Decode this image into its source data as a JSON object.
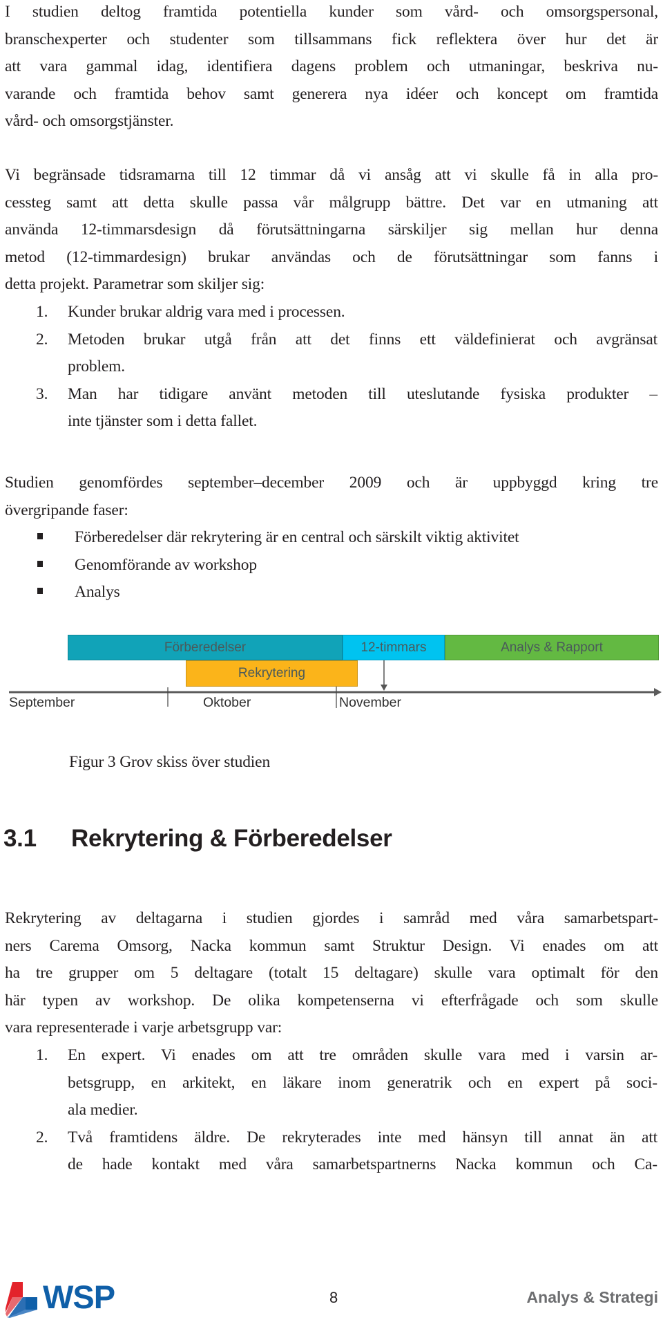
{
  "paragraphs": {
    "intro": [
      "I studien deltog framtida potentiella kunder som vård- och omsorgspersonal,",
      "branschexperter och studenter som tillsammans fick reflektera över hur det är",
      "att vara gammal idag, identifiera dagens problem och utmaningar, beskriva nu-",
      "varande och framtida behov samt generera nya idéer och koncept om framtida",
      "vård- och omsorgstjänster."
    ],
    "timeframe": [
      "Vi begränsade tidsramarna till 12 timmar då vi ansåg att vi skulle få in alla pro-",
      "cessteg samt att detta skulle passa vår målgrupp bättre. Det var en utmaning att",
      "använda 12-timmarsdesign då förutsättningarna särskiljer sig mellan hur denna",
      "metod (12-timmardesign) brukar användas och de förutsättningar som fanns i",
      "detta projekt. Parametrar som skiljer sig:"
    ],
    "phases_intro": [
      "Studien genomfördes september–december 2009 och är uppbyggd kring tre",
      "övergripande faser:"
    ],
    "recruitment": [
      "Rekrytering av deltagarna i studien gjordes i samråd med våra samarbetspart-",
      "ners Carema Omsorg, Nacka kommun samt Struktur Design. Vi enades om att",
      "ha tre grupper om 5 deltagare (totalt 15 deltagare) skulle vara optimalt för den",
      "här typen av workshop. De olika kompetenserna vi efterfrågade och som skulle",
      "vara representerade i varje arbetsgrupp var:"
    ]
  },
  "parameter_list": [
    {
      "num": "1.",
      "lines": [
        "Kunder brukar aldrig vara med i processen."
      ]
    },
    {
      "num": "2.",
      "lines": [
        "Metoden brukar utgå från att det finns ett väldefinierat och avgränsat",
        "problem."
      ]
    },
    {
      "num": "3.",
      "lines": [
        "Man har tidigare använt metoden till uteslutande fysiska produkter –",
        "inte tjänster som i detta fallet."
      ]
    }
  ],
  "phase_list": [
    "Förberedelser där rekrytering är en central och särskilt viktig aktivitet",
    "Genomförande av workshop",
    "Analys"
  ],
  "timeline": {
    "months": [
      "September",
      "Oktober",
      "November"
    ],
    "bars": [
      {
        "label": "Förberedelser",
        "color": "#11a3b8",
        "start": 0.35,
        "end": 1.93,
        "row": 0
      },
      {
        "label": "12-timmars",
        "color": "#00c3f0",
        "start": 1.93,
        "end": 2.52,
        "row": 0
      },
      {
        "label": "Analys & Rapport",
        "color": "#63b942",
        "start": 2.52,
        "end": 3.75,
        "row": 0
      },
      {
        "label": "Rekrytering",
        "color": "#fbb41a",
        "start": 1.03,
        "end": 2.02,
        "row": 1
      }
    ],
    "event_marker": 2.28
  },
  "caption": "Figur 3 Grov skiss över studien",
  "section": {
    "number": "3.1",
    "title": "Rekrytering & Förberedelser"
  },
  "competence_list": [
    {
      "num": "1.",
      "lines": [
        "En expert. Vi enades om att tre områden skulle vara med i varsin ar-",
        "betsgrupp, en arkitekt, en läkare inom generatrik och en expert på soci-",
        "ala medier."
      ]
    },
    {
      "num": "2.",
      "lines": [
        "Två framtidens äldre. De rekryterades inte med hänsyn till annat än att",
        "de hade kontakt med våra samarbetspartnerns Nacka kommun och Ca-"
      ]
    }
  ],
  "footer": {
    "logo_text": "WSP",
    "logo_color": "#0f5fa8",
    "logo_red": "#e3232b",
    "page_number": "8",
    "department": "Analys & Strategi"
  }
}
